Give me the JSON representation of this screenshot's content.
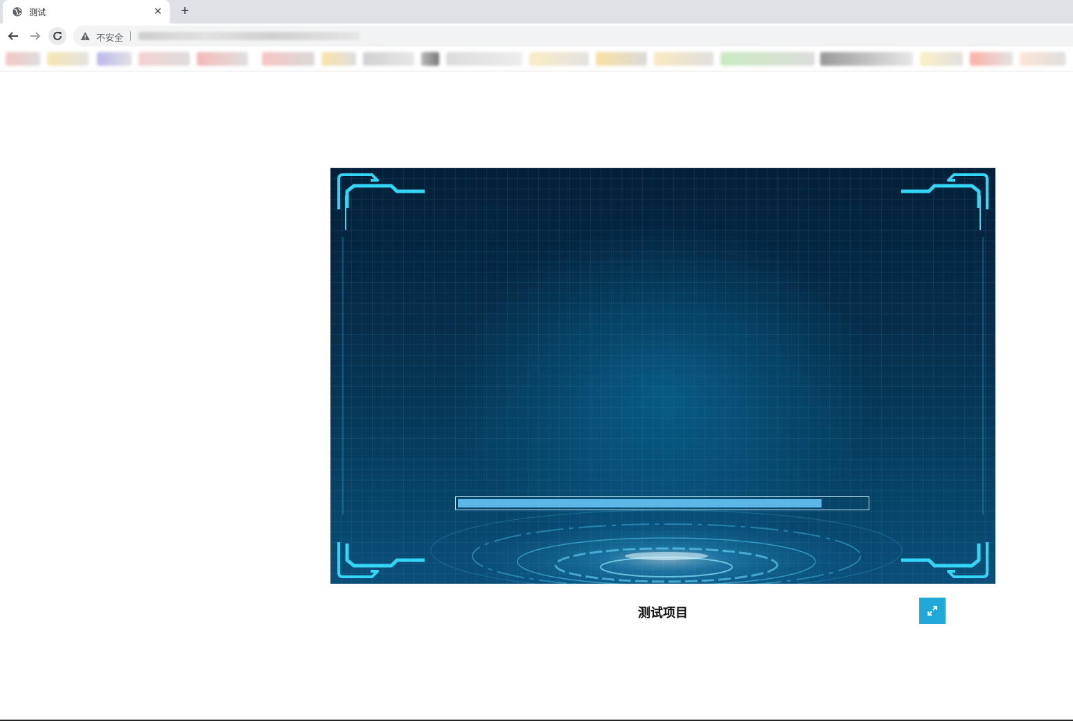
{
  "browser": {
    "tab": {
      "title": "测试",
      "favicon": "globe-icon",
      "close_icon": "close-icon"
    },
    "new_tab_icon": "plus-icon",
    "toolbar": {
      "back_icon": "arrow-left-icon",
      "forward_icon": "arrow-right-icon",
      "reload_icon": "reload-icon",
      "security_icon": "warning-icon",
      "security_label": "不安全"
    }
  },
  "page": {
    "display": {
      "progress": {
        "value": 0.89
      },
      "theme_colors": {
        "frame": "#33d6f5",
        "bar_fill": "#5cb6e6",
        "bar_border": "#c8ecff"
      }
    },
    "caption": "测试项目",
    "fullscreen_button": {
      "icon": "expand-icon",
      "color": "#1fa8d8"
    }
  }
}
